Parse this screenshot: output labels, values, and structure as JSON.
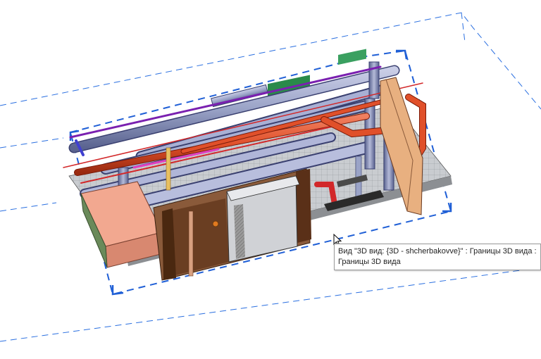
{
  "viewport": {
    "name": "3D вид: {3D - shcherbakovve}",
    "background": "#ffffff",
    "section_box_color": "#2a6fe0",
    "pipe_colors": {
      "duct": "#9aa3c7",
      "hot_water": "#e0502a",
      "cold_water": "#c8a060",
      "fire": "#d2282a",
      "magenta": "#e040c0",
      "green": "#2a8a4a"
    },
    "wall_color": "#8a5a3a",
    "floor_color": "#c4c8cc"
  },
  "tooltip": {
    "line1": "Вид \"3D вид: {3D - shcherbakovve}\" : Границы 3D вида :",
    "line2": "Границы 3D вида"
  },
  "cursor": {
    "icon": "arrow-cursor-icon"
  }
}
